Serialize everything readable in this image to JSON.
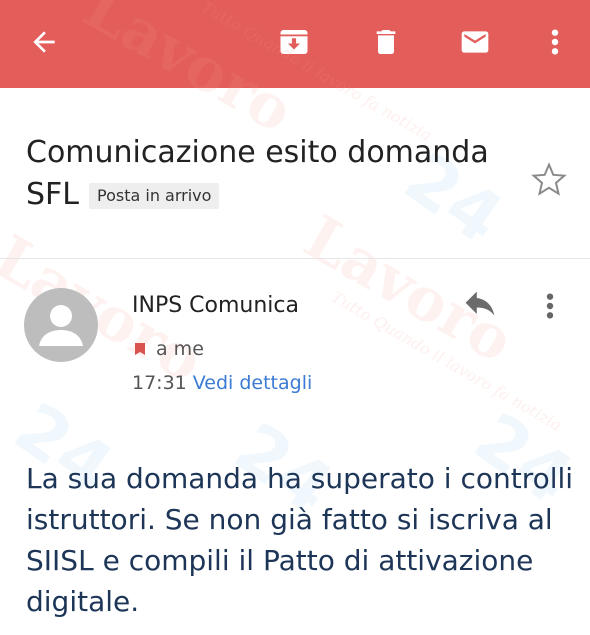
{
  "toolbar": {
    "back_icon": "arrow-back-icon",
    "archive_icon": "archive-icon",
    "delete_icon": "trash-icon",
    "mark_unread_icon": "mail-icon",
    "more_icon": "more-vert-icon",
    "color": "#e35d5a"
  },
  "email": {
    "subject": "Comunicazione esito domanda SFL",
    "label": "Posta in arrivo",
    "sender": "INPS Comunica",
    "recipient": "a me",
    "time": "17:31",
    "details_link": "Vedi dettagli",
    "body": "La sua domanda ha superato i controlli istruttori. Se non già fatto si iscriva al SIISL e compili il Patto di attivazione digitale."
  },
  "watermark": {
    "brand": "Lavoro",
    "number": "24",
    "tagline": "Tutto Quando il lavoro fa notizia"
  }
}
